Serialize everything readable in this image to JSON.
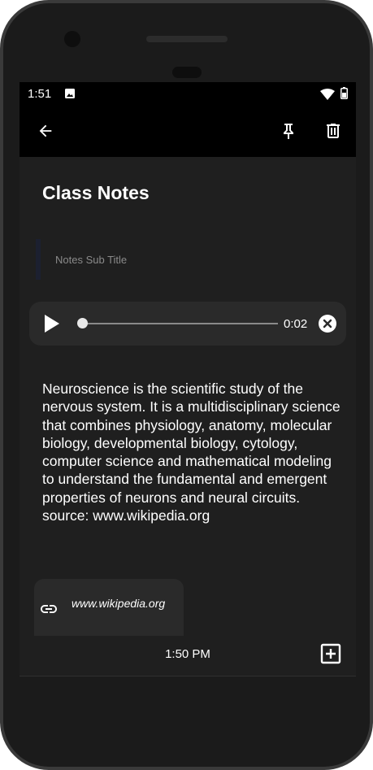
{
  "status": {
    "time": "1:51"
  },
  "note": {
    "title": "Class Notes",
    "subtitle": "Notes Sub Title",
    "body": "Neuroscience is the scientific study of the nervous system. It is a multidisciplinary science that combines physiology, anatomy, molecular biology, developmental biology, cytology, computer science and mathematical modeling to understand the fundamental and emergent properties of neurons and neural circuits. source: www.wikipedia.org"
  },
  "audio": {
    "elapsed": "0:02",
    "progress": 0.0
  },
  "link": {
    "text": "www.wikipedia.org"
  },
  "footer": {
    "timestamp": "1:50 PM"
  },
  "icons": {
    "back": "arrow-left-icon",
    "pin": "pin-icon",
    "delete": "trash-icon",
    "play": "play-icon",
    "close": "close-circle-icon",
    "link": "link-icon",
    "add": "add-box-icon"
  },
  "colors": {
    "background": "#1f1f1f",
    "appbar": "#000000",
    "card": "#2a2a2a",
    "text": "#ffffff",
    "muted": "#8a8a8a"
  }
}
